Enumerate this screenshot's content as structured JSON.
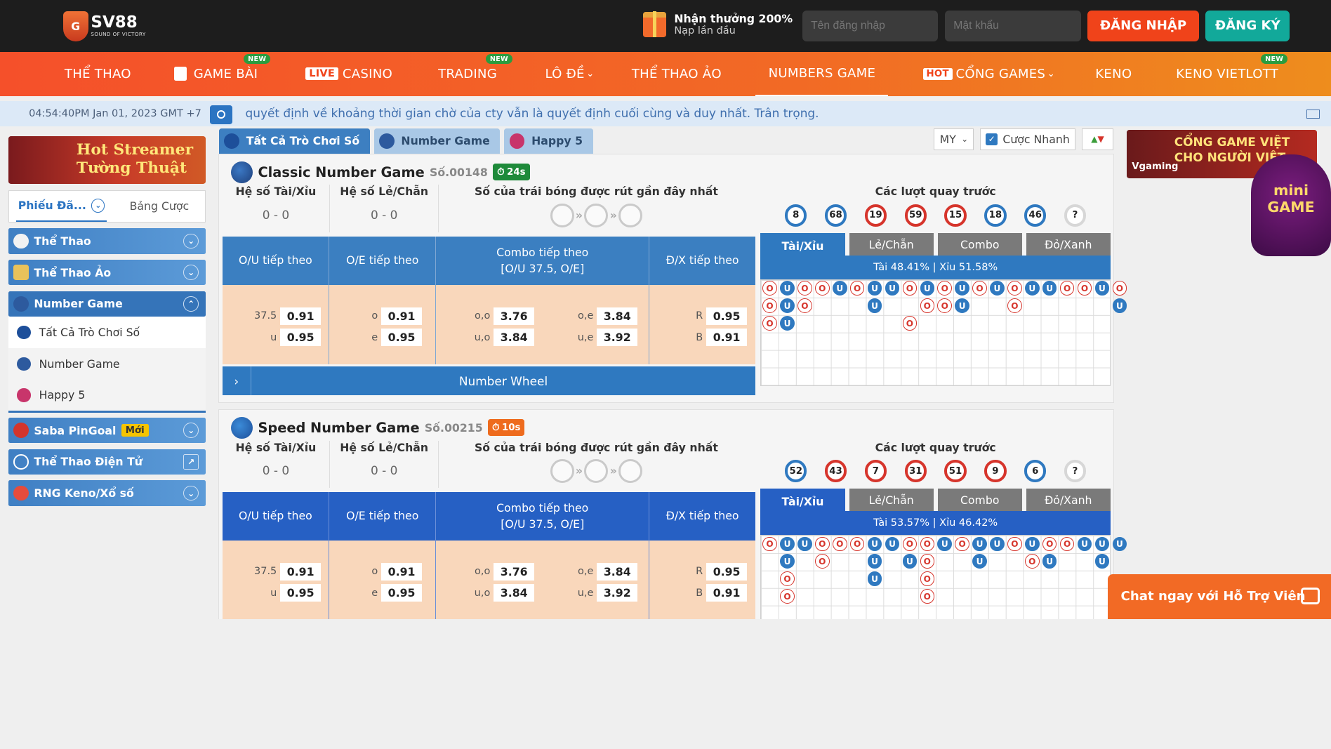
{
  "header": {
    "logo_text": "SV88",
    "logo_sub": "SOUND OF VICTORY",
    "promo_title": "Nhận thưởng 200%",
    "promo_sub": "Nạp lần đầu",
    "username_placeholder": "Tên đăng nhập",
    "password_placeholder": "Mật khẩu",
    "login_label": "ĐĂNG NHẬP",
    "register_label": "ĐĂNG KÝ"
  },
  "nav": {
    "items": [
      {
        "label": "THỂ THAO"
      },
      {
        "label": "GAME BÀI",
        "tag": "NEW"
      },
      {
        "label": "CASINO",
        "prefix": "LIVE"
      },
      {
        "label": "TRADING",
        "tag": "NEW"
      },
      {
        "label": "LÔ ĐỀ"
      },
      {
        "label": "THỂ THAO ẢO"
      },
      {
        "label": "NUMBERS GAME"
      },
      {
        "label": "CỔNG GAMES",
        "prefix": "HOT"
      },
      {
        "label": "KENO"
      },
      {
        "label": "KENO VIETLOTT",
        "tag": "NEW"
      }
    ]
  },
  "ticker": {
    "clock": "04:54:40PM Jan 01, 2023 GMT +7",
    "message": "quyết định về khoảng thời gian chờ của cty vẫn là quyết định cuối cùng và duy nhất. Trân trọng."
  },
  "sidebar": {
    "banner_line1": "Hot Streamer",
    "banner_line2": "Tường Thuật",
    "tab_bets": "Phiếu Đã...",
    "tab_odds": "Bảng Cược",
    "cats": [
      {
        "label": "Thể Thao"
      },
      {
        "label": "Thể Thao Ảo"
      },
      {
        "label": "Number Game"
      },
      {
        "label": "Saba PinGoal",
        "badge": "Mới"
      },
      {
        "label": "Thể Thao Điện Tử"
      },
      {
        "label": "RNG Keno/Xổ số"
      }
    ],
    "subs": [
      {
        "label": "Tất Cả Trò Chơi Số"
      },
      {
        "label": "Number Game"
      },
      {
        "label": "Happy 5"
      }
    ]
  },
  "game_tabs": [
    {
      "label": "Tất Cả Trò Chơi Số"
    },
    {
      "label": "Number Game"
    },
    {
      "label": "Happy 5"
    }
  ],
  "tools": {
    "odds_type": "MY",
    "quick_bet": "Cược Nhanh"
  },
  "common": {
    "tx_ratio_label": "Hệ số Tài/Xỉu",
    "le_chan_label": "Hệ số Lẻ/Chẵn",
    "drawn_label": "Số của trái bóng được rút gần đây nhất",
    "prev_label": "Các lượt quay trước",
    "ou_label": "O/U tiếp theo",
    "oe_label": "O/E tiếp theo",
    "combo_label1": "Combo tiếp theo",
    "combo_label2": "[O/U 37.5, O/E]",
    "dx_label": "Đ/X tiếp theo",
    "ptab_tx": "Tài/Xỉu",
    "ptab_lc": "Lẻ/Chẵn",
    "ptab_combo": "Combo",
    "ptab_dx": "Đỏ/Xanh",
    "wheel_label": "Number Wheel"
  },
  "games": [
    {
      "name": "Classic Number Game",
      "no": "Số.00148",
      "timer": "24s",
      "tx_value": "0 - 0",
      "lc_value": "0 - 0",
      "odds": {
        "ou_line": "37.5",
        "ou_over": "0.91",
        "ou_under_key": "u",
        "ou_under": "0.95",
        "oe_o_key": "o",
        "oe_o": "0.91",
        "oe_e_key": "e",
        "oe_e": "0.95",
        "combo_oo_key": "o,o",
        "combo_oo": "3.76",
        "combo_oe_key": "o,e",
        "combo_oe": "3.84",
        "combo_uo_key": "u,o",
        "combo_uo": "3.84",
        "combo_ue_key": "u,e",
        "combo_ue": "3.92",
        "dx_r_key": "R",
        "dx_r": "0.95",
        "dx_b_key": "B",
        "dx_b": "0.91"
      },
      "prev_balls": [
        "8",
        "68",
        "19",
        "59",
        "15",
        "18",
        "46",
        "?"
      ],
      "ratio": "Tài 48.41% | Xỉu 51.58%"
    },
    {
      "name": "Speed Number Game",
      "no": "Số.00215",
      "timer": "10s",
      "tx_value": "0 - 0",
      "lc_value": "0 - 0",
      "odds": {
        "ou_line": "37.5",
        "ou_over": "0.91",
        "ou_under_key": "u",
        "ou_under": "0.95",
        "oe_o_key": "o",
        "oe_o": "0.91",
        "oe_e_key": "e",
        "oe_e": "0.95",
        "combo_oo_key": "o,o",
        "combo_oo": "3.76",
        "combo_oe_key": "o,e",
        "combo_oe": "3.84",
        "combo_uo_key": "u,o",
        "combo_uo": "3.84",
        "combo_ue_key": "u,e",
        "combo_ue": "3.92",
        "dx_r_key": "R",
        "dx_r": "0.95",
        "dx_b_key": "B",
        "dx_b": "0.91"
      },
      "prev_balls": [
        "52",
        "43",
        "7",
        "31",
        "51",
        "9",
        "6",
        "?"
      ],
      "ratio": "Tài 53.57% | Xỉu 46.42%"
    }
  ],
  "right": {
    "vg_line1": "CỔNG GAME VIỆT",
    "vg_line2": "CHO NGƯỜI VIỆT",
    "vg_brand": "Vgaming",
    "mini1": "mini",
    "mini2": "GAME"
  },
  "chat_label": "Chat ngay với Hỗ Trợ Viên"
}
